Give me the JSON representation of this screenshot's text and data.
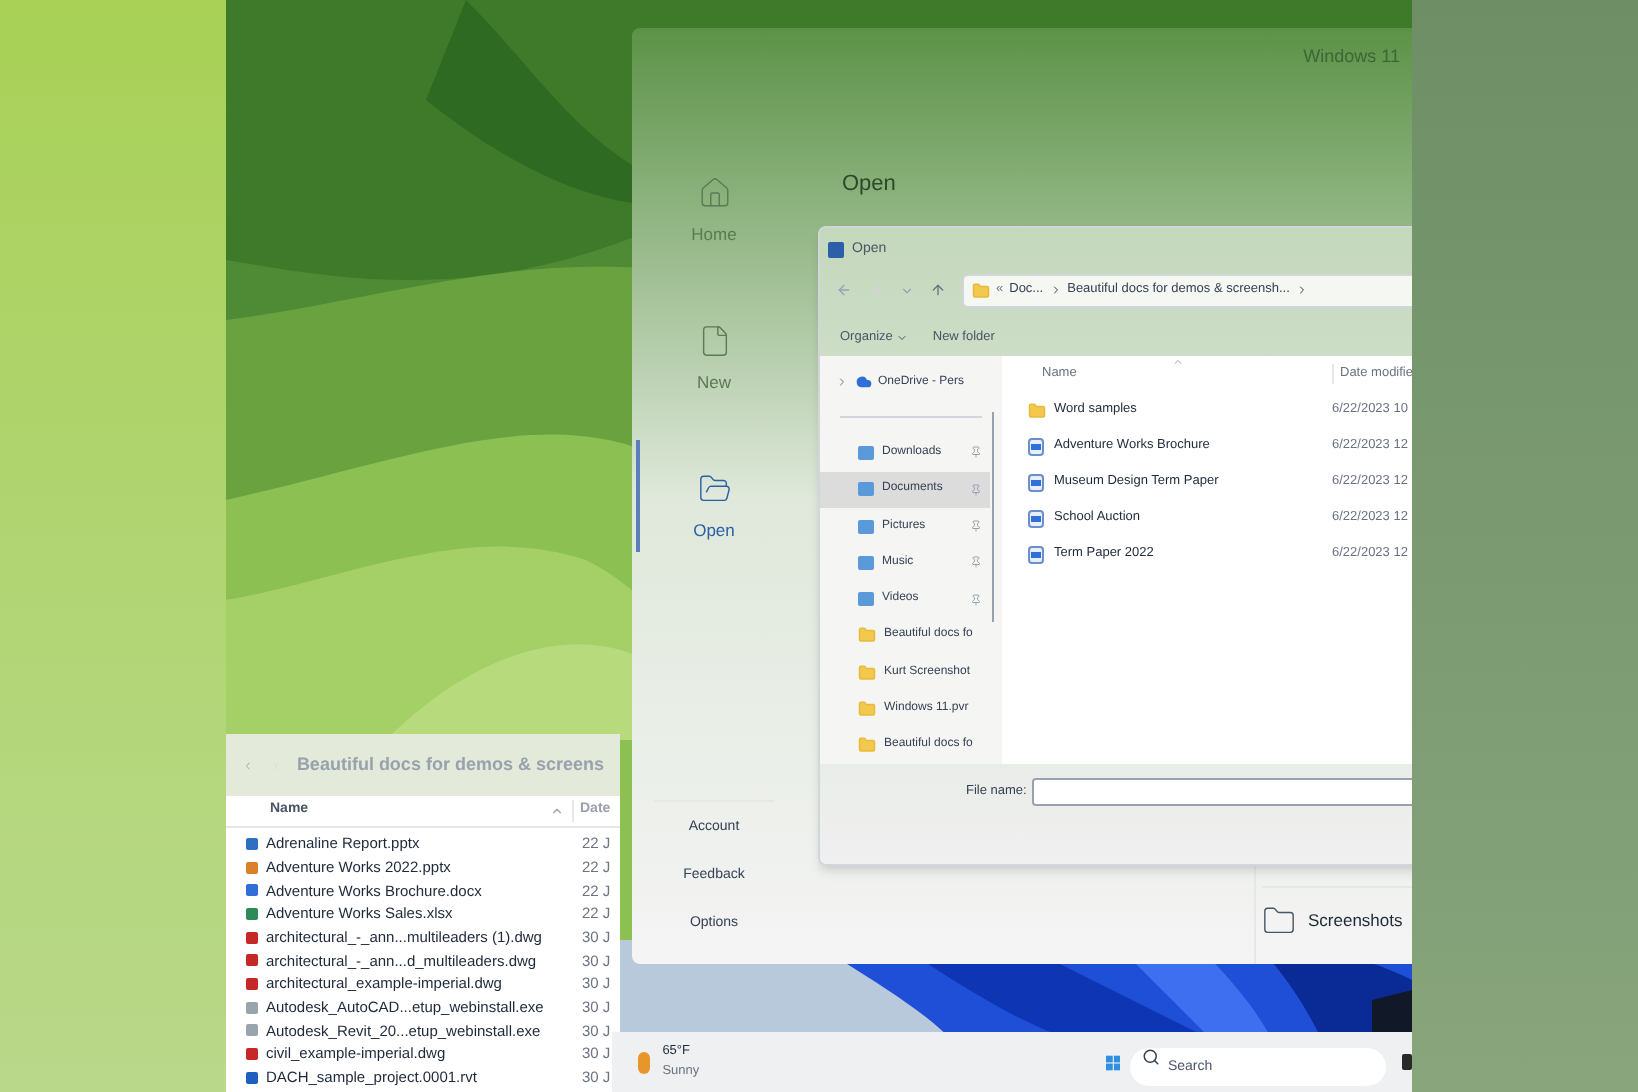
{
  "finder": {
    "title": "Beautiful docs for demos & screens",
    "columns": [
      "Name",
      "Date"
    ],
    "files": [
      {
        "name": "Adrenaline Report.pptx",
        "date": "22 J",
        "kind": "slides"
      },
      {
        "name": "Adventure Works 2022.pptx",
        "date": "22 J",
        "kind": "deck"
      },
      {
        "name": "Adventure Works Brochure.docx",
        "date": "22 J",
        "kind": "document"
      },
      {
        "name": "Adventure Works Sales.xlsx",
        "date": "22 J",
        "kind": "sheet"
      },
      {
        "name": "architectural_-_ann...multileaders (1).dwg",
        "date": "30 J",
        "kind": "drawing"
      },
      {
        "name": "architectural_-_ann...d_multileaders.dwg",
        "date": "30 J",
        "kind": "drawing"
      },
      {
        "name": "architectural_example-imperial.dwg",
        "date": "30 J",
        "kind": "drawing"
      },
      {
        "name": "Autodesk_AutoCAD...etup_webinstall.exe",
        "date": "30 J",
        "kind": "installer"
      },
      {
        "name": "Autodesk_Revit_20...etup_webinstall.exe",
        "date": "30 J",
        "kind": "installer"
      },
      {
        "name": "civil_example-imperial.dwg",
        "date": "30 J",
        "kind": "drawing"
      },
      {
        "name": "DACH_sample_project.0001.rvt",
        "date": "30 J",
        "kind": "model"
      }
    ]
  },
  "word": {
    "title": "Windows 11",
    "heading": "Open",
    "nav": [
      {
        "label": "Home",
        "selected": false
      },
      {
        "label": "New",
        "selected": false
      },
      {
        "label": "Open",
        "selected": true
      }
    ],
    "footer_nav": [
      "Account",
      "Feedback",
      "Options"
    ],
    "recent": [
      {
        "name": "Screenshots"
      }
    ]
  },
  "dialog": {
    "title": "Open",
    "path_prefix": "«",
    "path": [
      "Doc...",
      "Beautiful docs for demos & screensh..."
    ],
    "toolbar": [
      "Organize",
      "New folder"
    ],
    "nav": [
      {
        "label": "OneDrive - Pers",
        "kind": "cloud",
        "pinned": false,
        "selected": false
      },
      {
        "label": "Downloads",
        "kind": "library",
        "pinned": true,
        "selected": false
      },
      {
        "label": "Documents",
        "kind": "library",
        "pinned": true,
        "selected": true
      },
      {
        "label": "Pictures",
        "kind": "library",
        "pinned": true,
        "selected": false
      },
      {
        "label": "Music",
        "kind": "library",
        "pinned": true,
        "selected": false
      },
      {
        "label": "Videos",
        "kind": "library",
        "pinned": true,
        "selected": false
      },
      {
        "label": "Beautiful docs fo",
        "kind": "folder",
        "pinned": false,
        "selected": false
      },
      {
        "label": "Kurt Screenshot",
        "kind": "folder",
        "pinned": false,
        "selected": false
      },
      {
        "label": "Windows 11.pvr",
        "kind": "folder",
        "pinned": false,
        "selected": false
      },
      {
        "label": "Beautiful docs fo",
        "kind": "folder",
        "pinned": false,
        "selected": false
      }
    ],
    "columns": [
      "Name",
      "Date modifie"
    ],
    "files": [
      {
        "name": "Word samples",
        "kind": "folder",
        "date": "6/22/2023 10"
      },
      {
        "name": "Adventure Works Brochure",
        "kind": "document",
        "date": "6/22/2023 12"
      },
      {
        "name": "Museum Design Term Paper",
        "kind": "document",
        "date": "6/22/2023 12"
      },
      {
        "name": "School Auction",
        "kind": "document",
        "date": "6/22/2023 12"
      },
      {
        "name": "Term Paper 2022",
        "kind": "document",
        "date": "6/22/2023 12"
      }
    ],
    "file_name_label": "File name:"
  },
  "taskbar": {
    "temperature": "65°F",
    "condition": "Sunny",
    "search_placeholder": "Search"
  }
}
